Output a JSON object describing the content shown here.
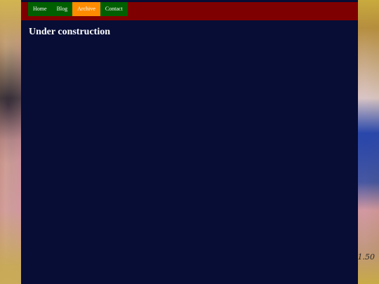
{
  "nav": {
    "items": [
      {
        "label": "Home",
        "active": false
      },
      {
        "label": "Blog",
        "active": false
      },
      {
        "label": "Archive",
        "active": true
      },
      {
        "label": "Contact",
        "active": false
      }
    ]
  },
  "main": {
    "title": "Under construction"
  },
  "background": {
    "signature": "1.50"
  },
  "colors": {
    "header_bar": "#7f0000",
    "nav_item": "#005f00",
    "nav_active": "#ff8c00",
    "page_bg": "#070d35"
  }
}
